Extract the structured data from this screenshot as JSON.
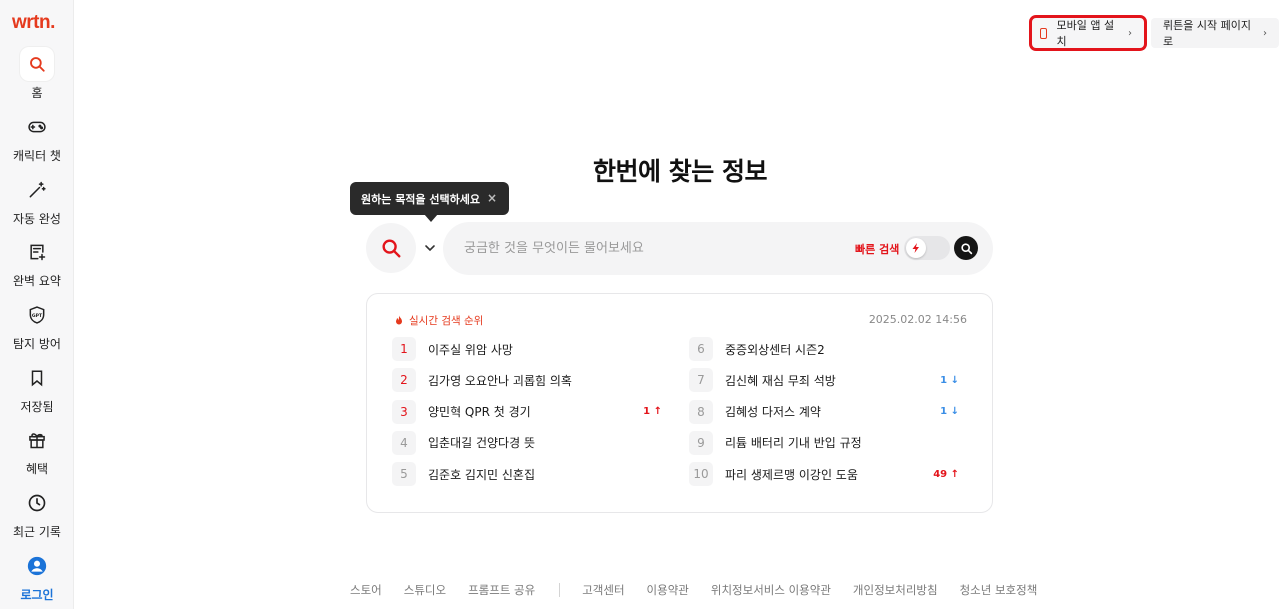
{
  "brand": {
    "logo": "wrtn.",
    "accent": "#e53a1e"
  },
  "sidebar": {
    "items": [
      {
        "label": "홈",
        "icon": "search-icon",
        "active": true
      },
      {
        "label": "캐릭터 챗",
        "icon": "gamepad-icon"
      },
      {
        "label": "자동 완성",
        "icon": "magic-wand-icon"
      },
      {
        "label": "완벽 요약",
        "icon": "document-add-icon"
      },
      {
        "label": "탐지 방어",
        "icon": "gpt-shield-icon"
      },
      {
        "label": "저장됨",
        "icon": "bookmark-icon"
      },
      {
        "label": "혜택",
        "icon": "gift-icon"
      },
      {
        "label": "최근 기록",
        "icon": "clock-icon"
      },
      {
        "label": "로그인",
        "icon": "user-icon"
      }
    ]
  },
  "topbar": {
    "mobile_app": "모바일 앱 설치",
    "start_page": "뤼튼을 시작 페이지로"
  },
  "headline": "한번에 찾는 정보",
  "tooltip": {
    "text": "원하는 목적을 선택하세요",
    "close": "×"
  },
  "search": {
    "placeholder": "궁금한 것을 무엇이든 물어보세요",
    "fast_search_label": "빠른 검색"
  },
  "trending": {
    "title": "실시간 검색 순위",
    "timestamp": "2025.02.02 14:56",
    "items": [
      {
        "rank": "1",
        "text": "이주실 위암 사망",
        "change": "",
        "dir": ""
      },
      {
        "rank": "2",
        "text": "김가영 오요안나 괴롭힘 의혹",
        "change": "",
        "dir": ""
      },
      {
        "rank": "3",
        "text": "양민혁 QPR 첫 경기",
        "change": "1 ↑",
        "dir": "up"
      },
      {
        "rank": "4",
        "text": "입춘대길 건양다경 뜻",
        "change": "",
        "dir": ""
      },
      {
        "rank": "5",
        "text": "김준호 김지민 신혼집",
        "change": "",
        "dir": ""
      },
      {
        "rank": "6",
        "text": "중증외상센터 시즌2",
        "change": "",
        "dir": ""
      },
      {
        "rank": "7",
        "text": "김신혜 재심 무죄 석방",
        "change": "1 ↓",
        "dir": "down"
      },
      {
        "rank": "8",
        "text": "김혜성 다저스 계약",
        "change": "1 ↓",
        "dir": "down"
      },
      {
        "rank": "9",
        "text": "리튬 배터리 기내 반입 규정",
        "change": "",
        "dir": ""
      },
      {
        "rank": "10",
        "text": "파리 생제르맹 이강인 도움",
        "change": "49 ↑",
        "dir": "up"
      }
    ]
  },
  "footer": {
    "left": [
      "스토어",
      "스튜디오",
      "프롬프트 공유"
    ],
    "right": [
      "고객센터",
      "이용약관",
      "위치정보서비스 이용약관",
      "개인정보처리방침",
      "청소년 보호정책"
    ]
  }
}
